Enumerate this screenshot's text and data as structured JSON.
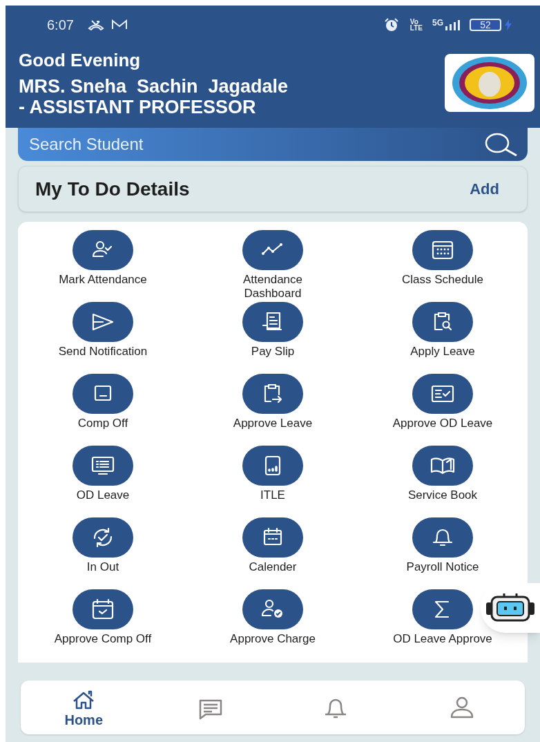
{
  "status_bar": {
    "time": "6:07",
    "volte_top": "Vo",
    "volte_bottom": "LTE",
    "network": "5G",
    "battery": "52"
  },
  "header": {
    "greeting": "Good Evening",
    "name": "MRS. Sneha  Sachin  Jagadale",
    "designation": "- ASSISTANT PROFESSOR"
  },
  "search": {
    "placeholder": "Search Student"
  },
  "todo": {
    "title": "My To Do Details",
    "action": "Add"
  },
  "menu": [
    {
      "label": "Mark Attendance"
    },
    {
      "label": "Attendance Dashboard"
    },
    {
      "label": "Class Schedule"
    },
    {
      "label": "Send Notification"
    },
    {
      "label": "Pay Slip"
    },
    {
      "label": "Apply Leave"
    },
    {
      "label": "Comp Off"
    },
    {
      "label": "Approve Leave"
    },
    {
      "label": "Approve OD Leave"
    },
    {
      "label": "OD Leave"
    },
    {
      "label": "ITLE"
    },
    {
      "label": "Service Book"
    },
    {
      "label": "In Out"
    },
    {
      "label": "Calender"
    },
    {
      "label": "Payroll Notice"
    },
    {
      "label": "Approve Comp Off"
    },
    {
      "label": "Approve Charge"
    },
    {
      "label": "OD Leave Approve"
    }
  ],
  "bottom_nav": [
    {
      "label": "Home",
      "selected": true
    },
    {
      "selected": false
    },
    {
      "selected": false
    },
    {
      "selected": false
    }
  ]
}
